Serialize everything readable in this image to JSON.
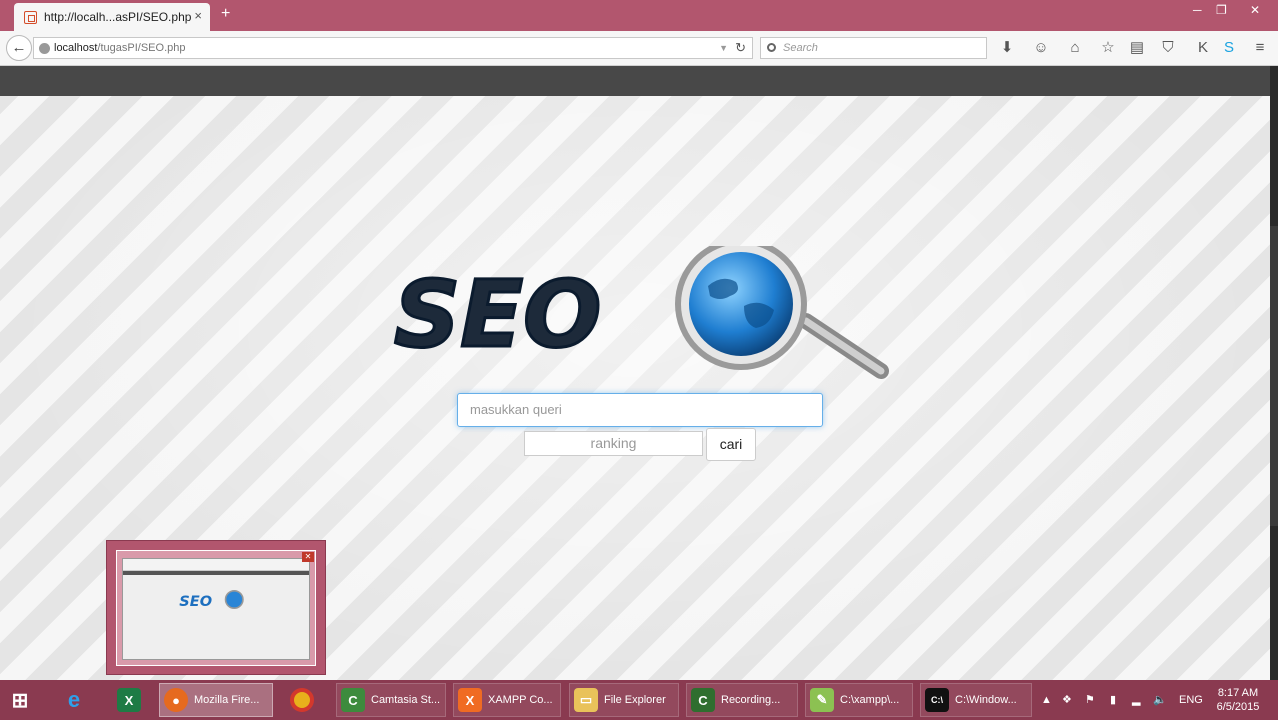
{
  "browser": {
    "tab_title": "http://localh...asPI/SEO.php",
    "tab_close": "×",
    "new_tab": "+",
    "url_host": "localhost",
    "url_path": "/tugasPI/SEO.php",
    "search_placeholder": "Search",
    "window_controls": [
      "─",
      "❐",
      "✕"
    ]
  },
  "page": {
    "logo_text": "SEO",
    "query_placeholder": "masukkan queri",
    "ranking_placeholder": "ranking",
    "search_button": "cari"
  },
  "taskbar": {
    "items": [
      {
        "label": "",
        "icon": "windows-start-icon"
      },
      {
        "label": "",
        "icon": "internet-explorer-icon"
      },
      {
        "label": "",
        "icon": "excel-icon"
      },
      {
        "label": "Mozilla Fire...",
        "icon": "firefox-icon",
        "active": true
      },
      {
        "label": "",
        "icon": "chrome-icon"
      },
      {
        "label": "Camtasia St...",
        "icon": "camtasia-icon"
      },
      {
        "label": "XAMPP Co...",
        "icon": "xampp-icon"
      },
      {
        "label": "File Explorer",
        "icon": "folder-icon"
      },
      {
        "label": "Recording...",
        "icon": "camtasia-recorder-icon"
      },
      {
        "label": "C:\\xampp\\...",
        "icon": "notepad-icon"
      },
      {
        "label": "C:\\Window...",
        "icon": "cmd-icon"
      }
    ],
    "language": "ENG",
    "time": "8:17 AM",
    "date": "6/5/2015"
  },
  "colors": {
    "titlebar": "#b2566e",
    "taskbar": "#8a3a50",
    "accent_focus": "#66afe9"
  }
}
